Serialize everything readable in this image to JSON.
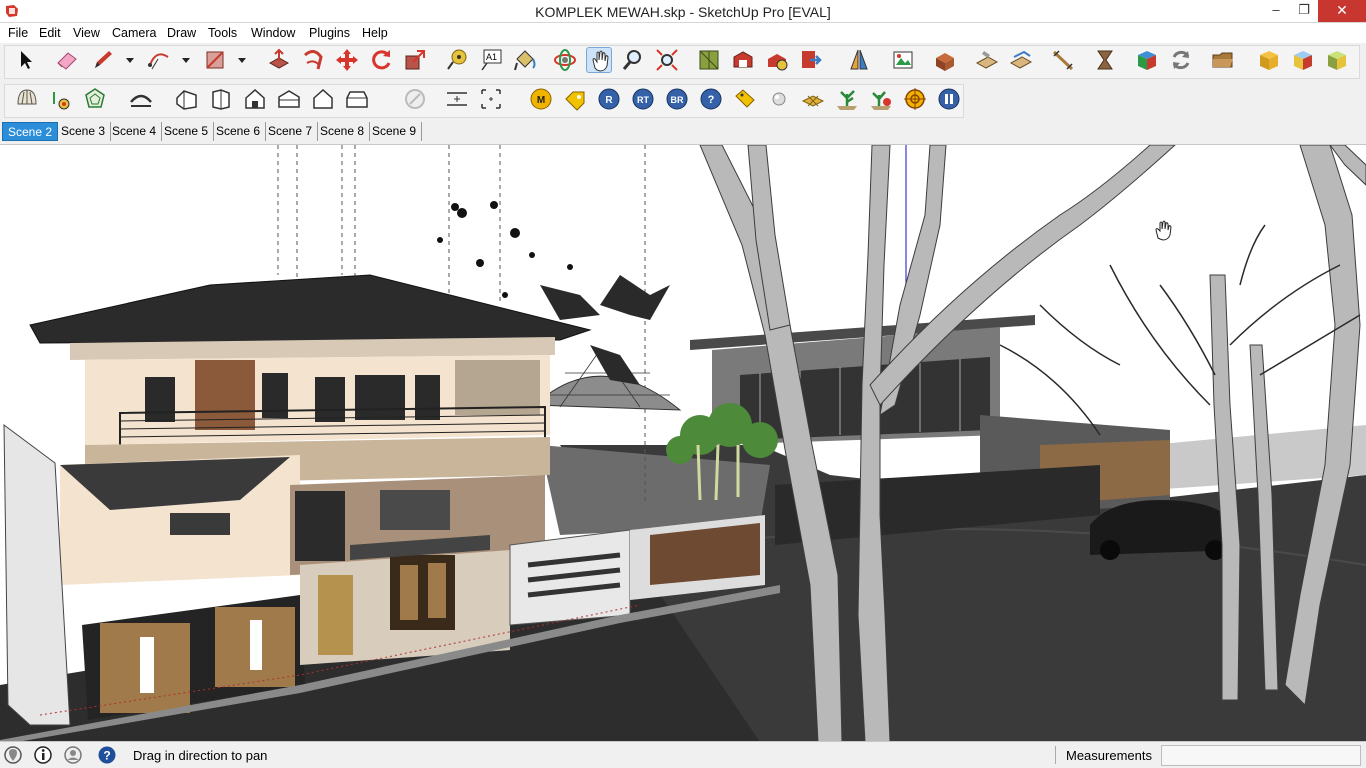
{
  "window": {
    "title": "KOMPLEK MEWAH.skp - SketchUp Pro [EVAL]",
    "app_icon": "sketchup-logo-icon",
    "controls": {
      "minimize": "–",
      "maximize": "❐",
      "close": "✕"
    }
  },
  "menu": [
    "File",
    "Edit",
    "View",
    "Camera",
    "Draw",
    "Tools",
    "Window",
    "Plugins",
    "Help"
  ],
  "scenes": {
    "active": "Scene 2",
    "tabs": [
      "Scene 2",
      "Scene 3",
      "Scene 4",
      "Scene 5",
      "Scene 6",
      "Scene 7",
      "Scene 8",
      "Scene 9"
    ]
  },
  "toolbar": {
    "row1_icons": [
      "select-icon",
      "eraser-icon",
      "pencil-icon",
      "arc-icon",
      "rectangle-icon",
      "push-pull-icon",
      "follow-me-icon",
      "move-icon",
      "rotate-icon",
      "scale-icon",
      "tape-measure-icon",
      "text-icon",
      "paint-bucket-icon",
      "orbit-icon",
      "pan-icon",
      "zoom-icon",
      "zoom-extents-icon",
      "sandbox-icon",
      "warehouse-icon",
      "extension-icon",
      "export-icon",
      "section-plane-icon",
      "photo-match-icon",
      "component-icon",
      "stamp-icon",
      "drape-icon",
      "dimension-icon",
      "curve-icon",
      "solid-icon",
      "reload-icon",
      "folder-icon",
      "cube-yellow-icon",
      "cube-blue-icon",
      "cube-green-icon"
    ],
    "row2_icons": [
      "shell-icon",
      "shadow-icon",
      "dodeca-icon",
      "round-corner-icon",
      "house-iso-icon",
      "house-right-icon",
      "house-front-icon",
      "house-top-icon",
      "house-outline-icon",
      "house-back-icon",
      "disabled-icon",
      "frame-icon",
      "center-icon"
    ],
    "row2_badges": [
      "M",
      "R",
      "RT",
      "BR",
      "?"
    ],
    "active_tool": "pan-icon"
  },
  "status": {
    "icons": [
      "geolocation-icon",
      "credits-icon",
      "user-icon",
      "help-icon"
    ],
    "message": "Drag in direction to pan",
    "measurements_label": "Measurements",
    "measurements_value": ""
  },
  "accent": {
    "selected": "#2c8ed8",
    "close": "#c7372f"
  }
}
